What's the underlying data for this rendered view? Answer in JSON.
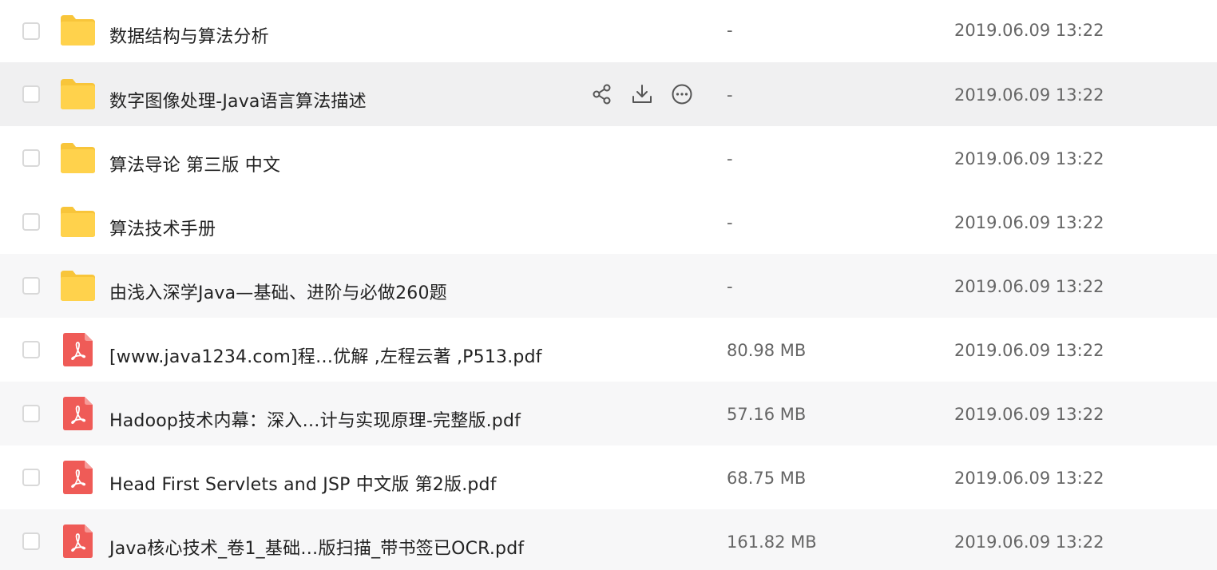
{
  "files": [
    {
      "name": "数据结构与算法分析",
      "type": "folder",
      "size": "-",
      "date": "2019.06.09 13:22"
    },
    {
      "name": "数字图像处理-Java语言算法描述",
      "type": "folder",
      "size": "-",
      "date": "2019.06.09 13:22"
    },
    {
      "name": "算法导论 第三版 中文",
      "type": "folder",
      "size": "-",
      "date": "2019.06.09 13:22"
    },
    {
      "name": "算法技术手册",
      "type": "folder",
      "size": "-",
      "date": "2019.06.09 13:22"
    },
    {
      "name": "由浅入深学Java—基础、进阶与必做260题",
      "type": "folder",
      "size": "-",
      "date": "2019.06.09 13:22"
    },
    {
      "name": "[www.java1234.com]程…优解 ,左程云著 ,P513.pdf",
      "type": "pdf",
      "size": "80.98 MB",
      "date": "2019.06.09 13:22"
    },
    {
      "name": "Hadoop技术内幕：深入…计与实现原理-完整版.pdf",
      "type": "pdf",
      "size": "57.16 MB",
      "date": "2019.06.09 13:22"
    },
    {
      "name": "Head First Servlets and JSP  中文版  第2版.pdf",
      "type": "pdf",
      "size": "68.75 MB",
      "date": "2019.06.09 13:22"
    },
    {
      "name": "Java核心技术_卷1_基础…版扫描_带书签已OCR.pdf",
      "type": "pdf",
      "size": "161.82 MB",
      "date": "2019.06.09 13:22"
    }
  ],
  "hover_row": 1,
  "row_actions": [
    "share-icon",
    "download-icon",
    "more-icon"
  ],
  "colors": {
    "folder": "#FFD24C",
    "folder_tab": "#F8C53A",
    "pdf": "#EF5B57",
    "action_icon": "#555555"
  }
}
